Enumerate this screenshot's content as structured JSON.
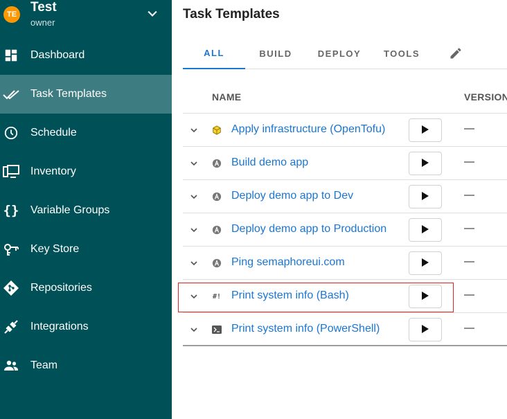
{
  "project": {
    "avatar_initials": "TE",
    "name": "Test",
    "role": "owner",
    "avatar_color": "#ff9800"
  },
  "sidebar": {
    "background": "#005057",
    "active_background": "#3d7c81",
    "items": [
      {
        "label": "Dashboard",
        "icon": "dashboard-icon"
      },
      {
        "label": "Task Templates",
        "icon": "double-check-icon",
        "active": true
      },
      {
        "label": "Schedule",
        "icon": "clock-icon"
      },
      {
        "label": "Inventory",
        "icon": "monitor-icon"
      },
      {
        "label": "Variable Groups",
        "icon": "braces-icon"
      },
      {
        "label": "Key Store",
        "icon": "key-icon"
      },
      {
        "label": "Repositories",
        "icon": "git-icon"
      },
      {
        "label": "Integrations",
        "icon": "plug-icon"
      },
      {
        "label": "Team",
        "icon": "team-icon"
      }
    ]
  },
  "main": {
    "title": "Task Templates",
    "tabs": [
      {
        "label": "ALL",
        "active": true
      },
      {
        "label": "BUILD"
      },
      {
        "label": "DEPLOY"
      },
      {
        "label": "TOOLS"
      }
    ],
    "columns": {
      "name": "NAME",
      "version": "VERSION"
    },
    "rows": [
      {
        "name": "Apply infrastructure (OpenTofu)",
        "app": "opentofu-icon",
        "version": "—"
      },
      {
        "name": "Build demo app",
        "app": "ansible-icon",
        "version": "—"
      },
      {
        "name": "Deploy demo app to Dev",
        "app": "ansible-icon",
        "version": "—"
      },
      {
        "name": "Deploy demo app to Production",
        "app": "ansible-icon",
        "version": "—"
      },
      {
        "name": "Ping semaphoreui.com",
        "app": "ansible-icon",
        "version": "—"
      },
      {
        "name": "Print system info (Bash)",
        "app": "bash-icon",
        "version": "—"
      },
      {
        "name": "Print system info (PowerShell)",
        "app": "powershell-icon",
        "version": "—"
      }
    ],
    "link_color": "#1976d2",
    "highlight_color": "#dd2222"
  }
}
